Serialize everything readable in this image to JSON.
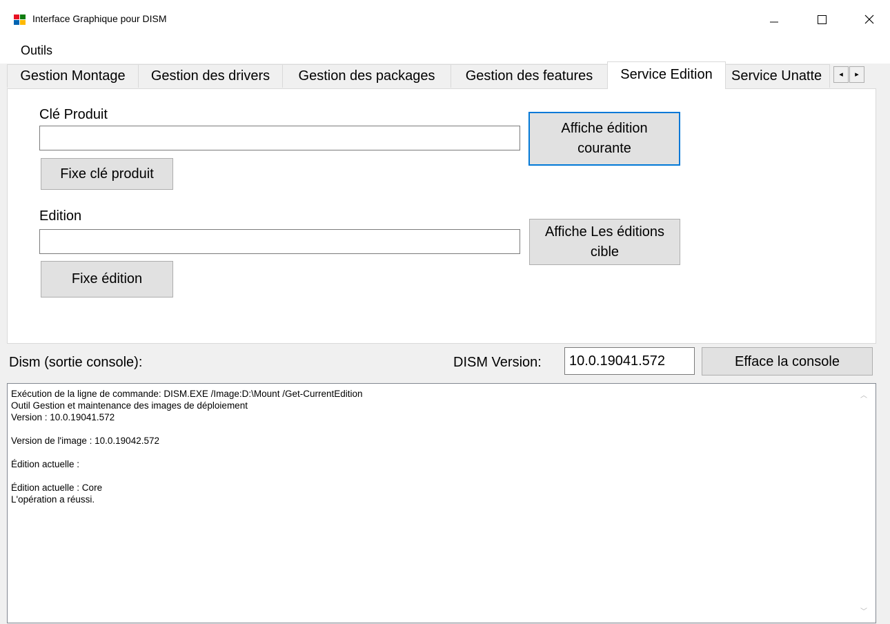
{
  "window": {
    "title": "Interface Graphique pour DISM"
  },
  "menu": {
    "items": [
      "Outils"
    ]
  },
  "tabs": [
    {
      "label": "Gestion Montage"
    },
    {
      "label": "Gestion des drivers"
    },
    {
      "label": "Gestion des packages"
    },
    {
      "label": "Gestion des features"
    },
    {
      "label": "Service Edition",
      "active": true
    },
    {
      "label": "Service Unatte"
    }
  ],
  "tab_scroll": {
    "left": "◂",
    "right": "▸"
  },
  "service_edition": {
    "product_key_label": "Clé Produit",
    "product_key_value": "",
    "set_key_button": "Fixe clé produit",
    "show_current_button_line1": "Affiche édition",
    "show_current_button_line2": "courante",
    "edition_label": "Edition",
    "edition_value": "",
    "set_edition_button": "Fixe édition",
    "show_targets_button_line1": "Affiche Les éditions",
    "show_targets_button_line2": "cible"
  },
  "console_section": {
    "label": "Dism (sortie console):",
    "version_label": "DISM Version:",
    "version_value": "10.0.19041.572",
    "clear_button": "Efface la console"
  },
  "console_output": "Exécution de la ligne de commande: DISM.EXE /Image:D:\\Mount /Get-CurrentEdition\nOutil Gestion et maintenance des images de déploiement\nVersion : 10.0.19041.572\n\nVersion de l'image : 10.0.19042.572\n\nÉdition actuelle :\n\nÉdition actuelle : Core\nL'opération a réussi.",
  "colors": {
    "accent": "#0078d7",
    "window_bg": "#f0f0f0",
    "button_bg": "#e1e1e1"
  }
}
